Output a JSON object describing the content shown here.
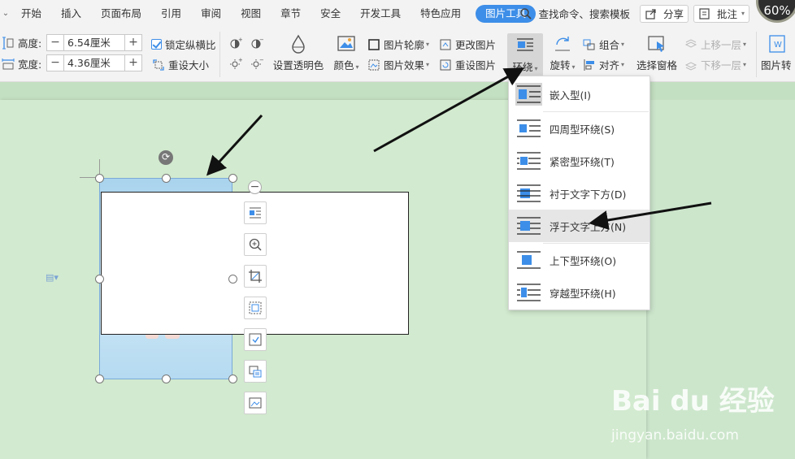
{
  "menubar": {
    "items": [
      "开始",
      "插入",
      "页面布局",
      "引用",
      "审阅",
      "视图",
      "章节",
      "安全",
      "开发工具",
      "特色应用"
    ],
    "active_tab": "图片工具",
    "search": "查找命令、搜索模板",
    "share": "分享",
    "annotate": "批注",
    "corner_text": "60%"
  },
  "ribbon": {
    "height_label": "高度:",
    "height_value": "6.54厘米",
    "width_label": "宽度:",
    "width_value": "4.36厘米",
    "lock_ratio": "锁定纵横比",
    "reset_size": "重设大小",
    "set_transparent": "设置透明色",
    "color": "颜色",
    "outline": "图片轮廓",
    "effects": "图片效果",
    "change_pic": "更改图片",
    "reset_pic": "重设图片",
    "wrap": "环绕",
    "rotate": "旋转",
    "group": "组合",
    "align": "对齐",
    "selection_pane": "选择窗格",
    "bring_forward": "上移一层",
    "send_backward": "下移一层",
    "pic_convert": "图片转"
  },
  "wrap_menu": {
    "items": [
      "嵌入型(I)",
      "四周型环绕(S)",
      "紧密型环绕(T)",
      "衬于文字下方(D)",
      "浮于文字上方(N)",
      "上下型环绕(O)",
      "穿越型环绕(H)"
    ]
  },
  "watermark": {
    "logo": "Bai du 经验",
    "url": "jingyan.baidu.com"
  },
  "colors": {
    "accent": "#3d8ee8",
    "page": "#d2eacf"
  }
}
